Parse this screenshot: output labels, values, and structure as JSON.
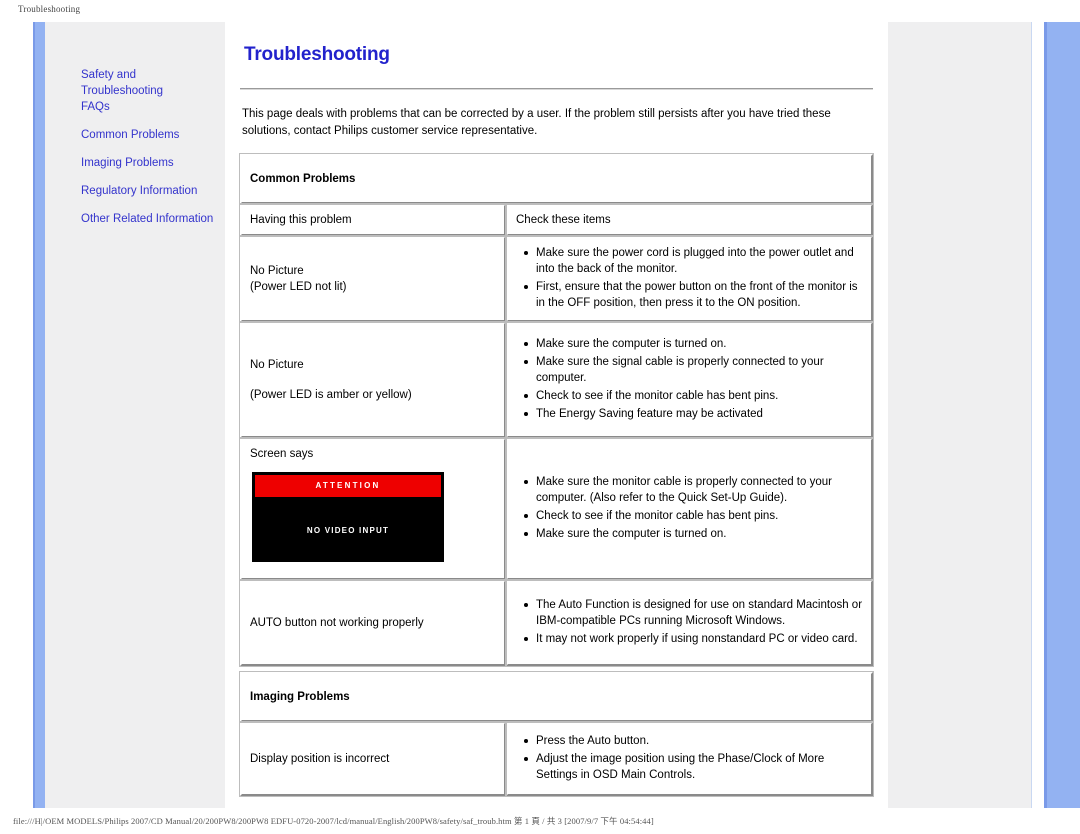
{
  "print": {
    "header": "Troubleshooting",
    "footer": "file:///H|/OEM MODELS/Philips 2007/CD Manual/20/200PW8/200PW8 EDFU-0720-2007/lcd/manual/English/200PW8/safety/saf_troub.htm 第 1 頁 / 共 3 [2007/9/7 下午 04:54:44]"
  },
  "colors": {
    "title_blue": "#2222CC",
    "link_blue": "#3333CC",
    "rail_blue": "#93B2F2",
    "panel_gray": "#EFEFF0",
    "attention_red": "#EE0000"
  },
  "sidebar": {
    "items": [
      {
        "label": "Safety and"
      },
      {
        "label": "Troubleshooting"
      },
      {
        "label": "FAQs"
      },
      {
        "label": "Common Problems"
      },
      {
        "label": "Imaging Problems"
      },
      {
        "label": "Regulatory Information"
      },
      {
        "label": "Other Related Information"
      }
    ]
  },
  "main": {
    "title": "Troubleshooting",
    "intro": "This page deals with problems that can be corrected by a user. If the problem still persists after you have tried these solutions, contact Philips customer service representative.",
    "common_problems": {
      "section_title": "Common Problems",
      "col_problem": "Having this problem",
      "col_check": "Check these items",
      "rows": [
        {
          "problem_line1": "No Picture",
          "problem_line2": "(Power LED not lit)",
          "checks": [
            "Make sure the power cord is plugged into the power outlet and into the back of the monitor.",
            "First, ensure that the power button on the front of the monitor is in the OFF position, then press it to the ON position."
          ]
        },
        {
          "problem_line1": "No Picture",
          "problem_line2": "(Power LED is amber or yellow)",
          "checks": [
            "Make sure the computer is turned on.",
            "Make sure the signal cable is properly connected to your computer.",
            "Check to see if the monitor cable has bent pins.",
            "The Energy Saving feature may be activated"
          ]
        },
        {
          "problem_line1": "Screen says",
          "osd": {
            "attention": "ATTENTION",
            "message": "NO VIDEO INPUT"
          },
          "checks": [
            "Make sure the monitor cable is properly connected to your computer. (Also refer to the Quick Set-Up Guide).",
            "Check to see if the monitor cable has bent pins.",
            "Make sure the computer is turned on."
          ]
        },
        {
          "problem_line1": "AUTO button not working properly",
          "checks": [
            "The Auto Function is designed for use on standard Macintosh or IBM-compatible PCs running Microsoft Windows.",
            "It may not work properly if using nonstandard PC or video card."
          ]
        }
      ]
    },
    "imaging_problems": {
      "section_title": "Imaging Problems",
      "rows": [
        {
          "problem_line1": "Display position is incorrect",
          "checks": [
            "Press the Auto button.",
            "Adjust the image position using the Phase/Clock of More Settings in OSD Main Controls."
          ]
        }
      ]
    }
  }
}
